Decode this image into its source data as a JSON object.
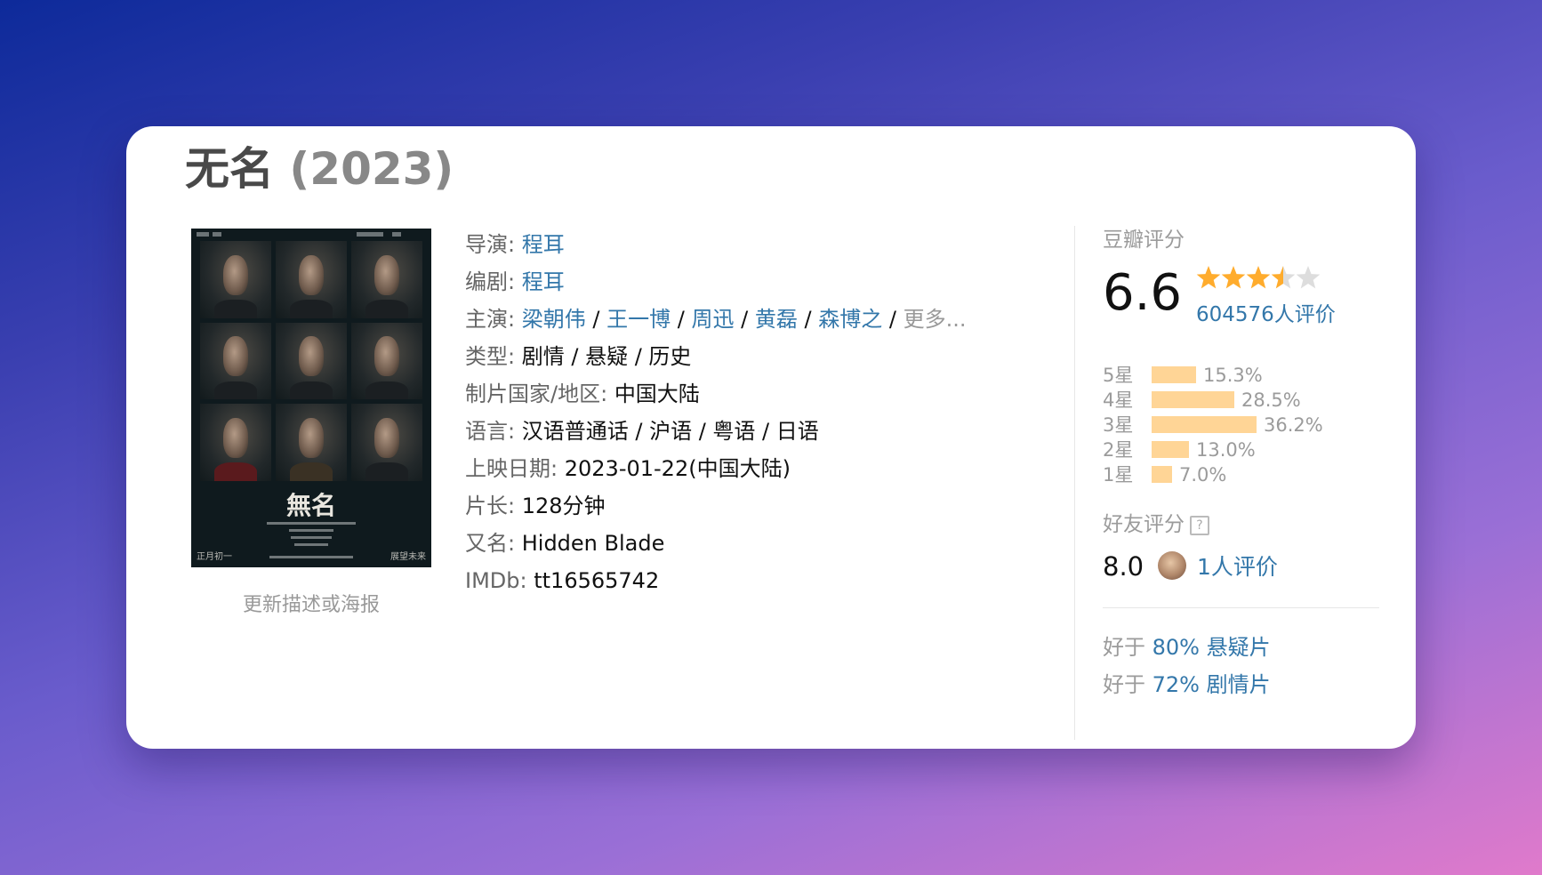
{
  "movie": {
    "title": "无名",
    "year": "(2023)"
  },
  "poster": {
    "title_calligraphy": "無名",
    "footer_left": "正月初一",
    "footer_right": "展望未来",
    "update_link": "更新描述或海报"
  },
  "info": {
    "director": {
      "label": "导演:",
      "value": "程耳"
    },
    "writer": {
      "label": "编剧:",
      "value": "程耳"
    },
    "cast": {
      "label": "主演:",
      "names": [
        "梁朝伟",
        "王一博",
        "周迅",
        "黄磊",
        "森博之"
      ],
      "separator": "/",
      "more": "更多..."
    },
    "genre": {
      "label": "类型:",
      "value": "剧情 / 悬疑 / 历史"
    },
    "country": {
      "label": "制片国家/地区:",
      "value": "中国大陆"
    },
    "language": {
      "label": "语言:",
      "value": "汉语普通话 / 沪语 / 粤语 / 日语"
    },
    "release": {
      "label": "上映日期:",
      "value": "2023-01-22(中国大陆)"
    },
    "runtime": {
      "label": "片长:",
      "value": "128分钟"
    },
    "aka": {
      "label": "又名:",
      "value": "Hidden Blade"
    },
    "imdb": {
      "label": "IMDb:",
      "value": "tt16565742"
    }
  },
  "rating": {
    "heading": "豆瓣评分",
    "score": "6.6",
    "stars": 3.5,
    "votes": "604576人评价",
    "distribution": [
      {
        "label": "5星",
        "percent": "15.3%",
        "value": 15.3
      },
      {
        "label": "4星",
        "percent": "28.5%",
        "value": 28.5
      },
      {
        "label": "3星",
        "percent": "36.2%",
        "value": 36.2
      },
      {
        "label": "2星",
        "percent": "13.0%",
        "value": 13.0
      },
      {
        "label": "1星",
        "percent": "7.0%",
        "value": 7.0
      }
    ]
  },
  "friends": {
    "heading": "好友评分",
    "help_icon": "?",
    "score": "8.0",
    "votes": "1人评价"
  },
  "better_than": [
    {
      "prefix": "好于",
      "value": "80% 悬疑片"
    },
    {
      "prefix": "好于",
      "value": "72% 剧情片"
    }
  ],
  "colors": {
    "link": "#3377aa",
    "star": "#ffac2d",
    "star_empty": "#dddddd",
    "bar": "#ffd596"
  }
}
